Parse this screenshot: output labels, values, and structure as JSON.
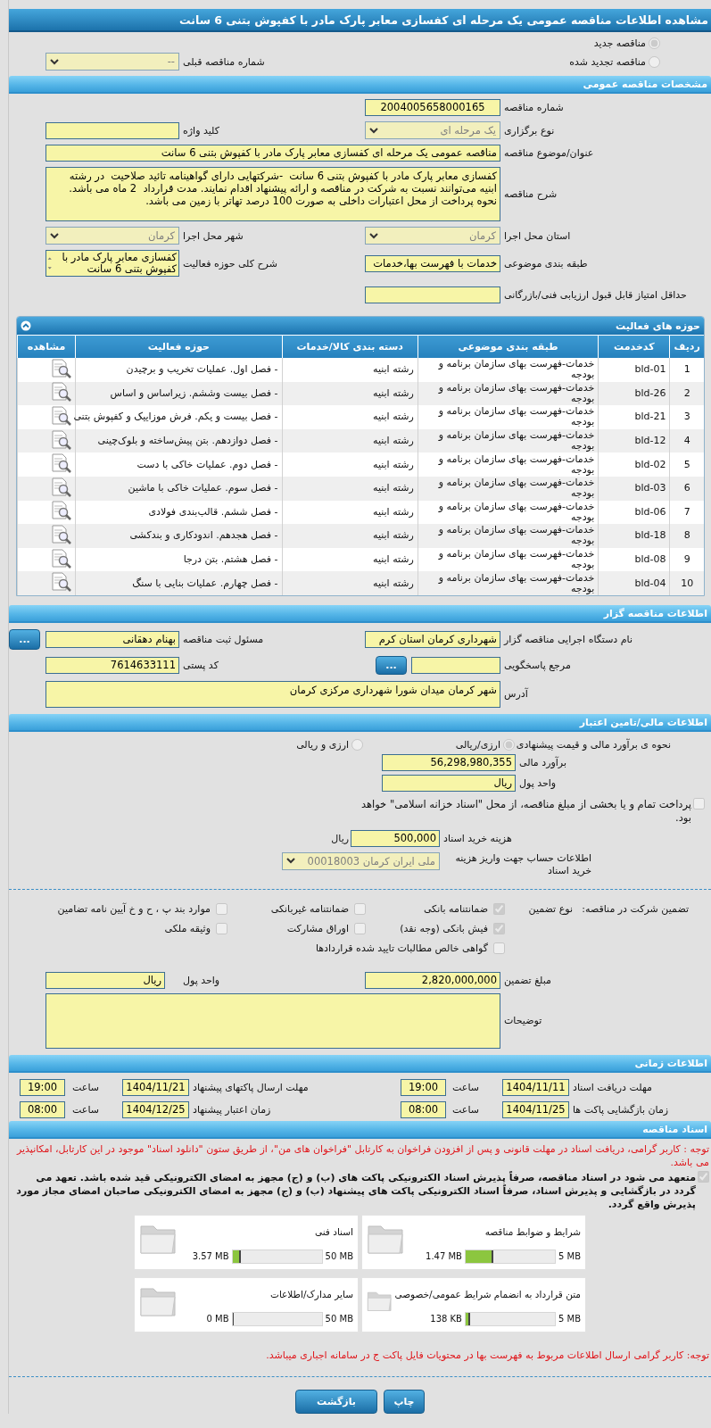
{
  "title": "مشاهده اطلاعات مناقصه عمومی یک مرحله ای کفسازی معابر پارک مادر با کفپوش بتنی 6 سانت",
  "tender_kind": [
    {
      "label": "مناقصه جدید",
      "selected": true
    },
    {
      "label": "مناقصه تجدید شده",
      "selected": false
    }
  ],
  "previous_tender": {
    "label": "شماره مناقصه قبلی",
    "value": "--"
  },
  "general": {
    "header": "مشخصات مناقصه عمومی",
    "rows": [
      [
        {
          "label": "شماره مناقصه",
          "value": "2004005658000165",
          "kind": "field"
        }
      ],
      [
        {
          "label": "نوع برگزاری",
          "value": "یک مرحله ای",
          "kind": "select"
        },
        {
          "label": "کلید واژه",
          "kind": "field"
        }
      ],
      [
        {
          "label": "عنوان/موضوع مناقصه",
          "value": "مناقصه عمومی یک مرحله ای کفسازی معابر پارک مادر با کفپوش بتنی 6 سانت",
          "kind": "longfield"
        }
      ],
      [
        {
          "label": "شرح مناقصه",
          "value": "کفسازی معابر پارک مادر با کفپوش بتنی 6 سانت  -شرکتهایی دارای گواهینامه تائید صلاحیت  در رشته ابنیه می‌توانند نسبت به شرکت در مناقصه و ارائه پیشنهاد اقدام نمایند. مدت قرارداد  2 ماه می باشد.\nنحوه پرداخت از محل اعتبارات داخلی به صورت 100 درصد تهاتر با زمین می باشد.",
          "kind": "memo"
        }
      ],
      [
        {
          "label": "استان محل اجرا",
          "value": "کرمان",
          "kind": "select"
        },
        {
          "label": "شهر محل اجرا",
          "value": "کرمان",
          "kind": "select"
        }
      ],
      [
        {
          "label": "طبقه بندی موضوعی",
          "value": "خدمات با فهرست بها،خدمات",
          "kind": "field"
        },
        {
          "label": "شرح کلی حوزه فعالیت",
          "value": "کفسازی معابر پارک مادر با کفپوش بتنی 6 سانت",
          "kind": "listbox"
        }
      ],
      [
        {
          "label": "حداقل امتیاز قابل قبول ارزیابی فنی/بازرگانی",
          "kind": "field"
        }
      ]
    ]
  },
  "activities": {
    "header": "حوزه های فعالیت",
    "expanded": true,
    "columns": [
      "ردیف",
      "کدخدمت",
      "طبقه بندی موضوعی",
      "دسته بندی کالا/خدمات",
      "حوزه فعالیت",
      "مشاهده"
    ],
    "rows": [
      {
        "index": "1",
        "code": "bld-01",
        "classification": "خدمات-فهرست بهای سازمان برنامه و بودجه",
        "category": "رشته ابنیه",
        "activity": "- فصل اول. عملیات تخریب و برچیدن"
      },
      {
        "index": "2",
        "code": "bld-26",
        "classification": "خدمات-فهرست بهای سازمان برنامه و بودجه",
        "category": "رشته ابنیه",
        "activity": "- فصل بیست وششم. زیراساس و اساس"
      },
      {
        "index": "3",
        "code": "bld-21",
        "classification": "خدمات-فهرست بهای سازمان برنامه و بودجه",
        "category": "رشته ابنیه",
        "activity": "- فصل بیست و یکم. فرش موزاییک و کفپوش بتنی"
      },
      {
        "index": "4",
        "code": "bld-12",
        "classification": "خدمات-فهرست بهای سازمان برنامه و بودجه",
        "category": "رشته ابنیه",
        "activity": "- فصل دوازدهم. بتن پیش‌ساخته و بلوک‌چینی"
      },
      {
        "index": "5",
        "code": "bld-02",
        "classification": "خدمات-فهرست بهای سازمان برنامه و بودجه",
        "category": "رشته ابنیه",
        "activity": "- فصل دوم. عملیات خاکی با دست"
      },
      {
        "index": "6",
        "code": "bld-03",
        "classification": "خدمات-فهرست بهای سازمان برنامه و بودجه",
        "category": "رشته ابنیه",
        "activity": "- فصل سوم. عملیات خاکی با ماشین"
      },
      {
        "index": "7",
        "code": "bld-06",
        "classification": "خدمات-فهرست بهای سازمان برنامه و بودجه",
        "category": "رشته ابنیه",
        "activity": "- فصل ششم. قالب‌بندی فولادی"
      },
      {
        "index": "8",
        "code": "bld-18",
        "classification": "خدمات-فهرست بهای سازمان برنامه و بودجه",
        "category": "رشته ابنیه",
        "activity": "- فصل هجدهم. اندودکاری و بندکشی"
      },
      {
        "index": "9",
        "code": "bld-08",
        "classification": "خدمات-فهرست بهای سازمان برنامه و بودجه",
        "category": "رشته ابنیه",
        "activity": "- فصل هشتم. بتن درجا"
      },
      {
        "index": "10",
        "code": "bld-04",
        "classification": "خدمات-فهرست بهای سازمان برنامه و بودجه",
        "category": "رشته ابنیه",
        "activity": "- فصل چهارم. عملیات بنایی با سنگ"
      }
    ]
  },
  "tenderer": {
    "header": "اطلاعات مناقصه گزار",
    "rows": [
      [
        {
          "label": "نام دستگاه اجرایی مناقصه گزار",
          "value": "شهرداری کرمان استان کرم",
          "kind": "field"
        },
        {
          "label": "مسئول ثبت مناقصه",
          "value": "بهنام دهقانی",
          "kind": "picker",
          "button": "..."
        }
      ],
      [
        {
          "label": "مرجع پاسخگویی",
          "kind": "picker",
          "button": "..."
        },
        {
          "label": "کد پستی",
          "value": "7614633111",
          "kind": "field"
        }
      ],
      [
        {
          "label": "آدرس",
          "value": "شهر کرمان میدان شورا شهرداری مرکزی کرمان",
          "kind": "memo"
        }
      ]
    ]
  },
  "financial": {
    "header": "اطلاعات مالی/تامین اعتبار",
    "estimate_method": {
      "label": "نحوه ی برآورد مالی و قیمت پیشنهادی",
      "options": [
        {
          "label": "ارزی/ریالی",
          "selected": true
        },
        {
          "label": "ارزی و ریالی",
          "selected": false
        }
      ]
    },
    "estimate": {
      "label": "برآورد مالی",
      "value": "56,298,980,355"
    },
    "currency": {
      "label": "واحد پول",
      "value": "ریال"
    },
    "treasury": {
      "label": "پرداخت تمام و یا بخشی از مبلغ مناقصه، از محل \"اسناد خزانه اسلامی\" خواهد بود.",
      "checked": false
    },
    "doc_fee": {
      "label": "هزینه خرید اسناد",
      "value": "500,000",
      "unit": "ریال"
    },
    "account": {
      "label": "اطلاعات حساب جهت واریز هزینه خرید اسناد",
      "value": "ملی ایران کرمان 00018003"
    }
  },
  "guarantee": {
    "label": "تضمین شرکت در مناقصه:",
    "type_label": "نوع تضمین",
    "options": [
      {
        "label": "ضمانتنامه بانکی",
        "checked": true
      },
      {
        "label": "ضمانتنامه غیربانکی",
        "checked": false
      },
      {
        "label": "موارد بند پ ، ح و خ آیین نامه تضامین",
        "checked": false
      },
      {
        "label": "فیش بانکی (وجه نقد)",
        "checked": true
      },
      {
        "label": "اوراق مشارکت",
        "checked": false
      },
      {
        "label": "وثیقه ملکی",
        "checked": false
      },
      {
        "label": "گواهی خالص مطالبات تایید شده قراردادها",
        "checked": false
      }
    ],
    "rows": [
      [
        {
          "label": "مبلغ تضمین",
          "value": "2,820,000,000",
          "kind": "field"
        },
        {
          "label": "واحد پول",
          "value": "ریال",
          "kind": "field"
        }
      ],
      [
        {
          "label": "توضیحات",
          "kind": "memo"
        }
      ]
    ]
  },
  "schedule": {
    "header": "اطلاعات زمانی",
    "rows": [
      [
        {
          "label": "مهلت دریافت اسناد",
          "date": "1404/11/11",
          "time_label": "ساعت",
          "time": "19:00"
        },
        {
          "label": "مهلت ارسال پاکتهای پیشنهاد",
          "date": "1404/11/21",
          "time_label": "ساعت",
          "time": "19:00"
        }
      ],
      [
        {
          "label": "زمان بازگشایی پاکت ها",
          "date": "1404/11/25",
          "time_label": "ساعت",
          "time": "08:00"
        },
        {
          "label": "زمان اعتبار پیشنهاد",
          "date": "1404/12/25",
          "time_label": "ساعت",
          "time": "08:00"
        }
      ]
    ]
  },
  "documents": {
    "header": "اسناد مناقصه",
    "notice": "توجه : کاربر گرامی، دریافت اسناد در مهلت قانونی و پس از افزودن فراخوان به کارتابل \"فراخوان های من\"، از طریق ستون \"دانلود اسناد\" موجود در این کارتابل، امکانپذیر می باشد.",
    "pledge": {
      "text": "متعهد می شود در اسناد مناقصه، صرفاً پذیرش اسناد الکترونیکی پاکت های (ب) و (ج) مجهز به امضای الکترونیکی قید شده باشد. تعهد می گردد در بازگشایی و پذیرش اسناد، صرفاً اسناد الکترونیکی پاکت های پیشنهاد (ب) و (ج) مجهز به امضای الکترونیکی صاحبان امضای مجاز مورد پذیرش واقع گردد.",
      "checked": true
    },
    "files": [
      {
        "title": "شرایط و ضوابط مناقصه",
        "limit": "5 MB",
        "used": "1.47 MB",
        "level": 0.294
      },
      {
        "title": "اسناد فنی",
        "limit": "50 MB",
        "used": "3.57 MB",
        "level": 0.071
      },
      {
        "title": "متن قرارداد به انضمام شرایط عمومی/خصوصی",
        "limit": "5 MB",
        "used": "138 KB",
        "level": 0.027
      },
      {
        "title": "سایر مدارک/اطلاعات",
        "limit": "50 MB",
        "used": "0 MB",
        "level": 0
      }
    ],
    "footer_note": "توجه: کاربر گرامی ارسال اطلاعات مربوط به فهرست بها در محتویات فایل پاکت ج در سامانه اجباری میباشد."
  },
  "buttons": [
    "چاپ",
    "بازگشت"
  ]
}
